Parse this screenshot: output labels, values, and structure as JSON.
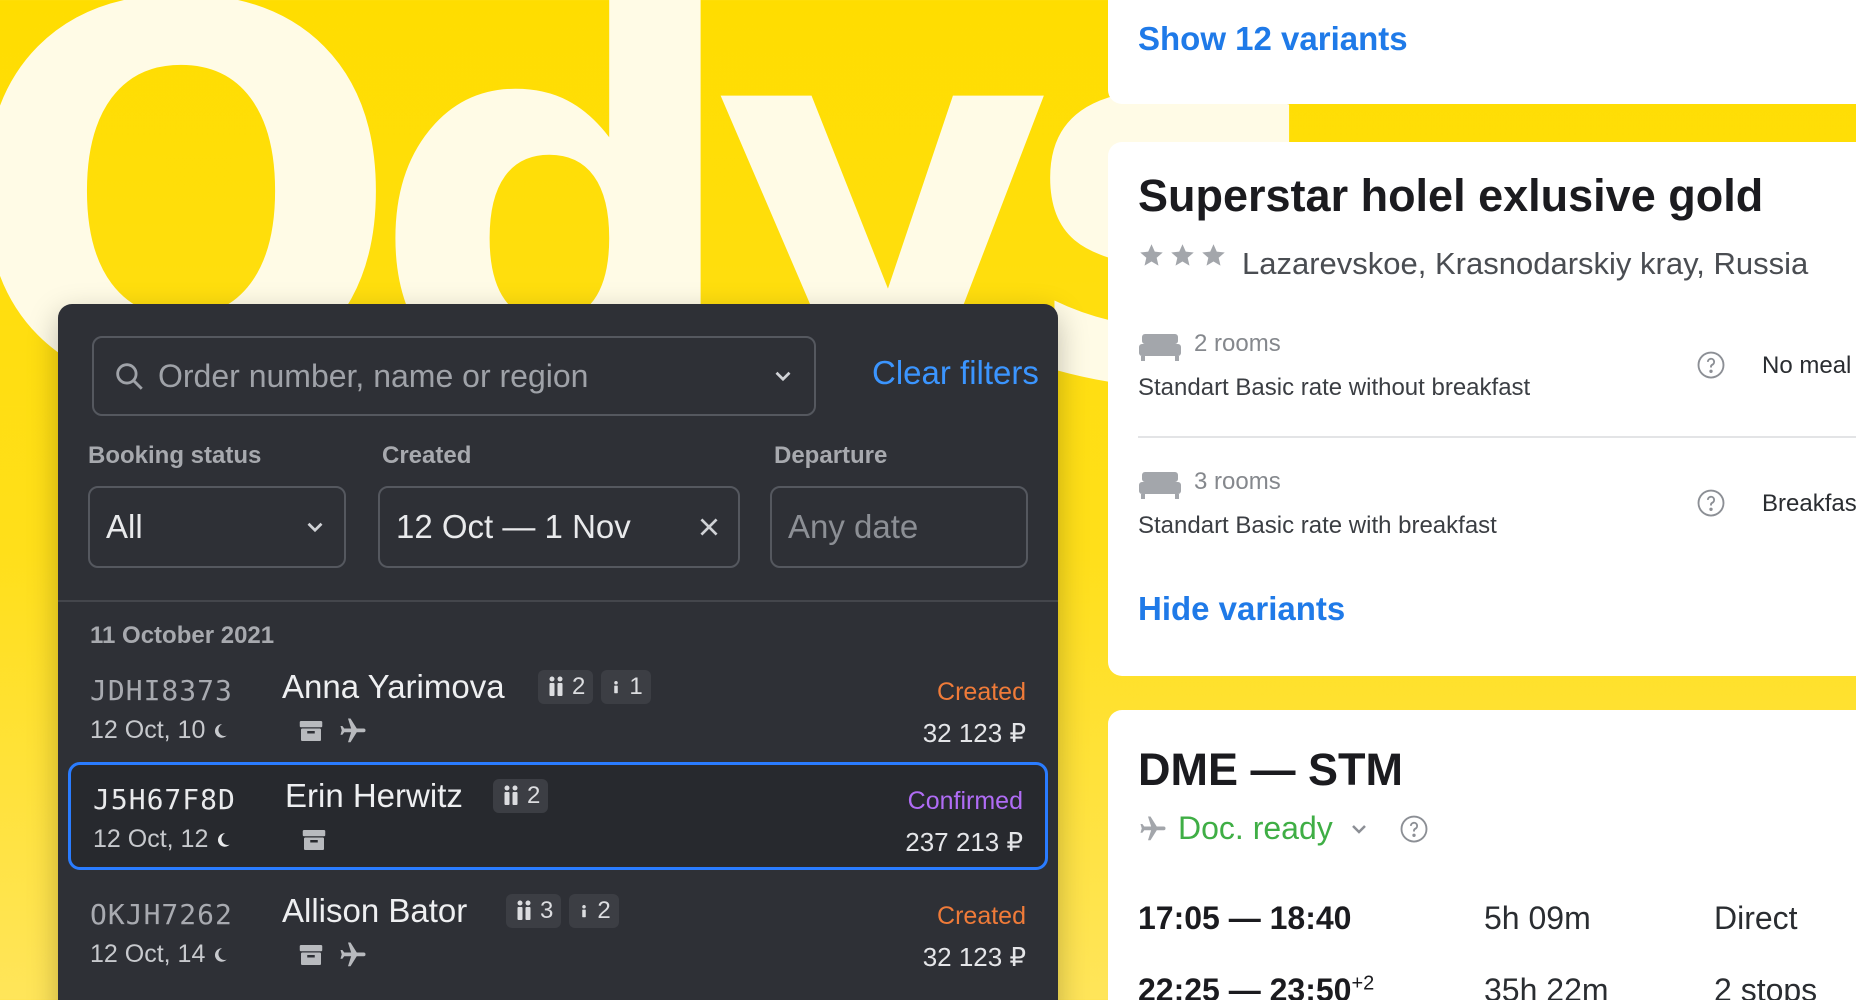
{
  "background": {
    "logo_text": "Odys"
  },
  "booking_panel": {
    "search": {
      "placeholder": "Order number, name or region"
    },
    "clear_filters_label": "Clear filters",
    "filters": {
      "booking_status": {
        "label": "Booking status",
        "value": "All"
      },
      "created": {
        "label": "Created",
        "value": "12 Oct — 1 Nov"
      },
      "departure": {
        "label": "Departure",
        "placeholder": "Any date"
      }
    },
    "date_group": "11 October 2021",
    "orders": [
      {
        "id": "JDHI8373",
        "when": "12 Oct, 10",
        "name": "Anna Yarimova",
        "adults": "2",
        "children": "1",
        "status": "Created",
        "price": "32 123 ₽",
        "selected": false
      },
      {
        "id": "J5H67F8D",
        "when": "12 Oct, 12",
        "name": "Erin Herwitz",
        "adults": "2",
        "status": "Confirmed",
        "price": "237 213 ₽",
        "selected": true
      },
      {
        "id": "OKJH7262",
        "when": "12 Oct, 14",
        "name": "Allison Bator",
        "adults": "3",
        "children": "2",
        "status": "Created",
        "price": "32 123 ₽",
        "selected": false
      }
    ]
  },
  "variants_card": {
    "show_variants_label": "Show 12 variants"
  },
  "hotel_card": {
    "title": "Superstar holel exlusive gold",
    "stars": 3,
    "location": "Lazarevskoe, Krasnodarskiy kray, Russia",
    "rooms": [
      {
        "count": "2 rooms",
        "rate": "Standart Basic rate without breakfast",
        "meal": "No meal"
      },
      {
        "count": "3 rooms",
        "rate": "Standart Basic rate with breakfast",
        "meal": "Breakfas"
      }
    ],
    "hide_variants_label": "Hide variants"
  },
  "flight_card": {
    "route": "DME — STM",
    "doc_status": "Doc. ready",
    "flights": [
      {
        "times": "17:05 — 18:40",
        "day_offset": "",
        "duration": "5h 09m",
        "stops": "Direct"
      },
      {
        "times": "22:25 — 23:50",
        "day_offset": "+2",
        "duration": "35h 22m",
        "stops": "2 stops"
      }
    ]
  },
  "colors": {
    "brand_yellow": "#ffdd00",
    "panel_dark": "#2e3036",
    "link_blue": "#1f7ae8",
    "status_created": "#f07b39",
    "status_confirmed": "#b06cf5",
    "doc_ready_green": "#3fae45",
    "selection_blue": "#2a7cff"
  }
}
